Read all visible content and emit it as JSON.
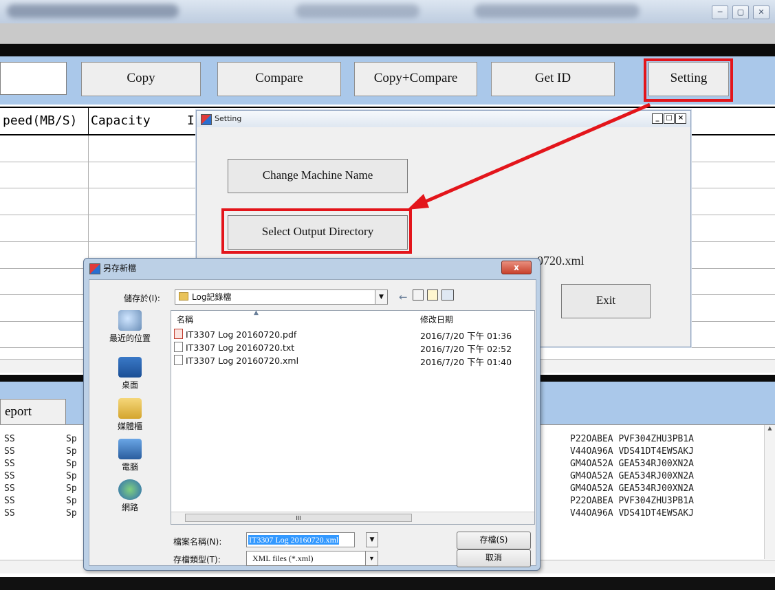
{
  "window": {
    "minimize": "─",
    "maximize": "▢",
    "close": "✕"
  },
  "toolbar": {
    "copy": "Copy",
    "compare": "Compare",
    "copy_compare": "Copy+Compare",
    "get_id": "Get ID",
    "setting": "Setting"
  },
  "table": {
    "columns": [
      "peed(MB/S)",
      "Capacity",
      "I"
    ]
  },
  "lower": {
    "report_tab": "eport",
    "rows": [
      {
        "a": "SS",
        "b": "Sp",
        "sn": "P22OABEA PVF304ZHU3PB1A"
      },
      {
        "a": "SS",
        "b": "Sp",
        "sn": "V44OA96A VDS41DT4EWSAKJ"
      },
      {
        "a": "SS",
        "b": "Sp",
        "sn": "GM4OA52A GEA534RJ00XN2A"
      },
      {
        "a": "SS",
        "b": "Sp",
        "sn": "GM4OA52A GEA534RJ00XN2A"
      },
      {
        "a": "SS",
        "b": "Sp",
        "sn": "GM4OA52A GEA534RJ00XN2A"
      },
      {
        "a": "SS",
        "b": "Sp",
        "sn": "P22OABEA PVF304ZHU3PB1A"
      },
      {
        "a": "SS",
        "b": "Sp",
        "sn": "V44OA96A VDS41DT4EWSAKJ"
      }
    ]
  },
  "setting_dialog": {
    "title": "Setting",
    "ctrl_min": "_",
    "ctrl_max": "□",
    "ctrl_close": "×",
    "change_machine_name": "Change Machine Name",
    "select_output_directory": "Select Output Directory",
    "output_path_tail": "0720.xml",
    "exit": "Exit"
  },
  "save_dialog": {
    "title": "另存新檔",
    "close": "x",
    "save_in_label": "儲存於(I):",
    "save_in_value": "Log記錄檔",
    "places": [
      "最近的位置",
      "桌面",
      "媒體櫃",
      "電腦",
      "網路"
    ],
    "col_name": "名稱",
    "col_date": "修改日期",
    "files": [
      {
        "name": "IT3307 Log 20160720.pdf",
        "date": "2016/7/20 下午 01:36"
      },
      {
        "name": "IT3307 Log 20160720.txt",
        "date": "2016/7/20 下午 02:52"
      },
      {
        "name": "IT3307 Log 20160720.xml",
        "date": "2016/7/20 下午 01:40"
      }
    ],
    "scroll_mark": "III",
    "filename_label": "檔案名稱(N):",
    "filename_value": "IT3307 Log 20160720.xml",
    "filetype_label": "存檔類型(T):",
    "filetype_value": "XML files (*.xml)",
    "save_button": "存檔(S)",
    "cancel_button": "取消"
  },
  "colors": {
    "highlight": "#e3151b",
    "toolbar": "#aac8ea"
  }
}
